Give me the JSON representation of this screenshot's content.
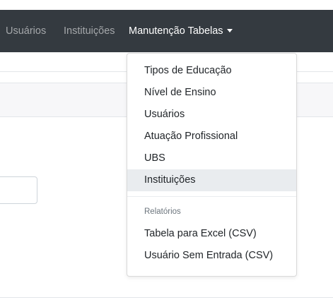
{
  "navbar": {
    "links": [
      {
        "label": "Usuários"
      },
      {
        "label": "Instituições"
      },
      {
        "label": "Manutenção Tabelas"
      }
    ]
  },
  "dropdown": {
    "items": [
      {
        "label": "Tipos de Educação"
      },
      {
        "label": "Nível de Ensino"
      },
      {
        "label": "Usuários"
      },
      {
        "label": "Atuação Profissional"
      },
      {
        "label": "UBS"
      },
      {
        "label": "Instituições"
      }
    ],
    "header": "Relatórios",
    "report_items": [
      {
        "label": "Tabela para Excel (CSV)"
      },
      {
        "label": "Usuário Sem Entrada (CSV)"
      }
    ]
  }
}
